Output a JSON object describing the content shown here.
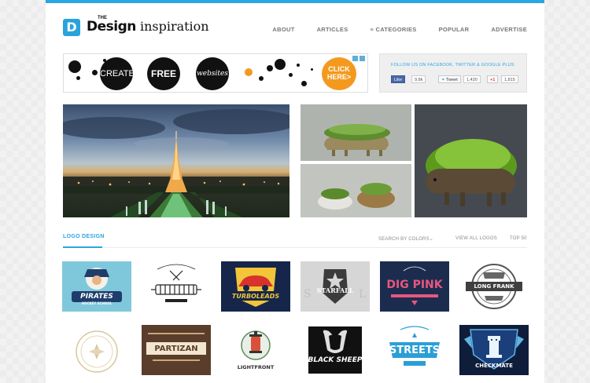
{
  "header": {
    "logo_mark": "D",
    "logo_the": "THE",
    "logo_design": "Design",
    "logo_inspiration": " inspiration",
    "nav": [
      "ABOUT",
      "ARTICLES",
      "≡ CATEGORIES",
      "POPULAR",
      "ADVERTISE"
    ]
  },
  "ad": {
    "circles": [
      "CREATE",
      "FREE",
      "websites"
    ],
    "cta": "CLICK HERE>"
  },
  "social": {
    "title": "FOLLOW US ON FACEBOOK, TWITTER & GOOGLE PLUS",
    "like_label": "Like",
    "like_count": "9.8k",
    "tweet_label": "Tweet",
    "tweet_count": "1,430",
    "gplus_label": "+1",
    "gplus_count": "1,815"
  },
  "section": {
    "title": "LOGO DESIGN",
    "search_colors": "SEARCH BY COLORS⌄",
    "view_all": "VIEW ALL LOGOS",
    "top50": "TOP 50"
  },
  "logos_row1": [
    "PIRATES",
    "HOCKEY SCHOOL",
    "TURBOLEADS",
    "STARFALL",
    "DIG PINK",
    "LONG FRANK"
  ],
  "logos_row2": [
    "CHECKMATE",
    "BLACK SHEEP",
    "STREETS",
    "LIGHTFRONT",
    "PARTIZAN"
  ],
  "colors": {
    "accent": "#2aa6e0",
    "ad_orange": "#f39a1e"
  }
}
